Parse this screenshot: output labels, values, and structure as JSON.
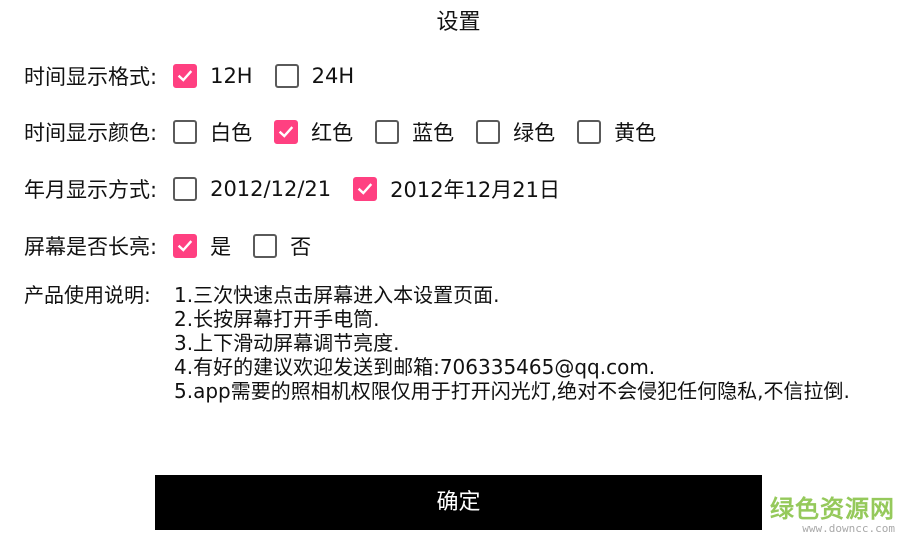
{
  "title": "设置",
  "time_format": {
    "label": "时间显示格式:",
    "options": [
      {
        "label": "12H",
        "checked": true
      },
      {
        "label": "24H",
        "checked": false
      }
    ]
  },
  "time_color": {
    "label": "时间显示颜色:",
    "options": [
      {
        "label": "白色",
        "checked": false
      },
      {
        "label": "红色",
        "checked": true
      },
      {
        "label": "蓝色",
        "checked": false
      },
      {
        "label": "绿色",
        "checked": false
      },
      {
        "label": "黄色",
        "checked": false
      }
    ]
  },
  "date_format": {
    "label": "年月显示方式:",
    "options": [
      {
        "label": "2012/12/21",
        "checked": false
      },
      {
        "label": "2012年12月21日",
        "checked": true
      }
    ]
  },
  "screen_on": {
    "label": "屏幕是否长亮:",
    "options": [
      {
        "label": "是",
        "checked": true
      },
      {
        "label": "否",
        "checked": false
      }
    ]
  },
  "instructions": {
    "label": "产品使用说明:",
    "lines": [
      "1.三次快速点击屏幕进入本设置页面.",
      "2.长按屏幕打开手电筒.",
      "3.上下滑动屏幕调节亮度.",
      "4.有好的建议欢迎发送到邮箱:706335465@qq.com.",
      "5.app需要的照相机权限仅用于打开闪光灯,绝对不会侵犯任何隐私,不信拉倒."
    ]
  },
  "confirm_label": "确定",
  "watermark": {
    "main": "绿色资源网",
    "sub": "www.downcc.com"
  },
  "colors": {
    "checked": "#ff4081",
    "unchecked_border": "#5a5a5a",
    "button_bg": "#000000",
    "button_text": "#ffffff"
  },
  "icons": {
    "checked": "checkmark-icon",
    "unchecked": "empty-box"
  }
}
